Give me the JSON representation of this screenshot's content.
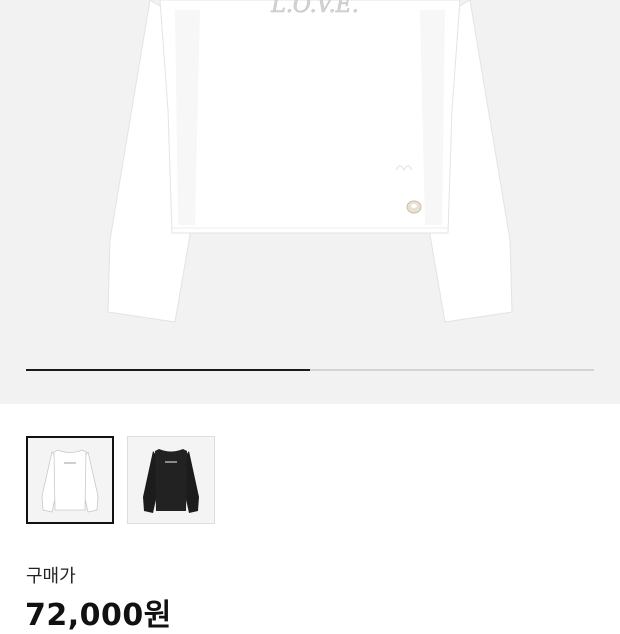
{
  "product": {
    "hero_image": "white-long-sleeve-tee-front",
    "logo_print": "L.O.V.E.",
    "gallery_progress": 0.5
  },
  "thumbnails": [
    {
      "image": "white-long-sleeve-tee",
      "selected": true
    },
    {
      "image": "black-long-sleeve-tee",
      "selected": false
    }
  ],
  "price": {
    "label": "구매가",
    "value": "72,000원"
  },
  "colors": {
    "hero_bg": "#f2f2f2",
    "progress_active": "#1a1a1a",
    "progress_track": "#d4d4d4",
    "text_primary": "#111111"
  }
}
